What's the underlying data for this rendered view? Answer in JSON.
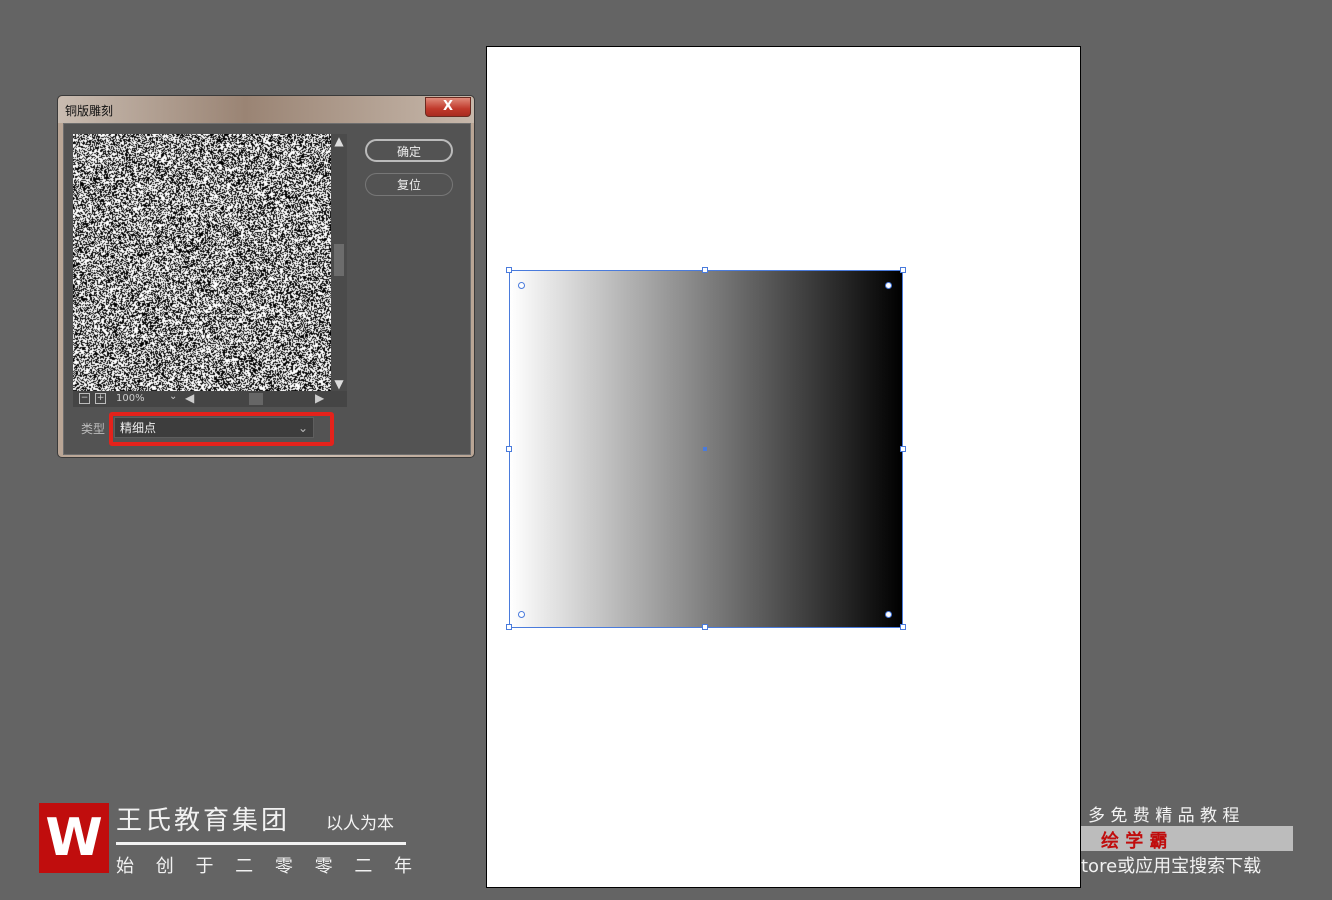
{
  "dialog": {
    "title": "铜版雕刻",
    "close_label": "X",
    "ok_label": "确定",
    "reset_label": "复位",
    "zoom_level": "100%",
    "zoom_out": "−",
    "zoom_in": "+",
    "type_label": "类型",
    "type_value": "精细点"
  },
  "watermark_left": {
    "logo": "W",
    "company": "王氏教育集团",
    "slogan": "以人为本",
    "founded": "始 创 于 二 零 零 二 年"
  },
  "watermark_right": {
    "line1": "多 免 费 精 品 教 程",
    "brand": "绘 学 霸",
    "line3": "tore或应用宝搜索下载"
  },
  "colors": {
    "highlight": "#e4221b",
    "selection": "#4a7bdc",
    "brand": "#c00d0d"
  }
}
